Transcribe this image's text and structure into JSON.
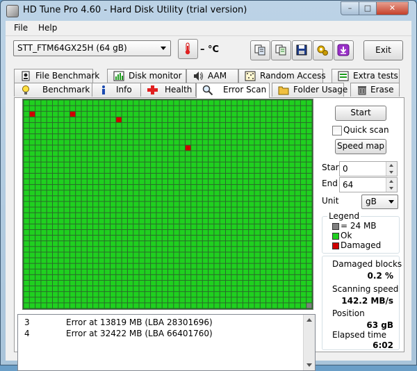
{
  "window": {
    "title": "HD Tune Pro 4.60 - Hard Disk Utility (trial version)",
    "controls": {
      "minimize": "–",
      "maximize": "□",
      "close": "✕"
    }
  },
  "menu": [
    "File",
    "Help"
  ],
  "toolbar": {
    "drive": "STT_FTM64GX25H (64 gB)",
    "temperature": "– °C",
    "exit_label": "Exit",
    "buttons": [
      "copy-info-icon",
      "copy-text-icon",
      "save-icon",
      "options-icon",
      "download-icon"
    ]
  },
  "tabs": {
    "row1": [
      "File Benchmark",
      "Disk monitor",
      "AAM",
      "Random Access",
      "Extra tests"
    ],
    "row2": [
      "Benchmark",
      "Info",
      "Health",
      "Error Scan",
      "Folder Usage",
      "Erase"
    ],
    "active": "Error Scan"
  },
  "scan_map": {
    "cols": 50,
    "rows": 37,
    "colors": {
      "ok": "#1fd01f",
      "damaged": "#d00000",
      "unscanned": "#7f7f7f",
      "gridline": "#2a6a2a"
    },
    "damaged_blocks": [
      [
        1,
        2
      ],
      [
        8,
        2
      ],
      [
        16,
        3
      ],
      [
        28,
        8
      ]
    ],
    "unscanned_blocks": [
      [
        49,
        36
      ]
    ]
  },
  "log": [
    {
      "index": "3",
      "message": "Error at 13819 MB (LBA 28301696)"
    },
    {
      "index": "4",
      "message": "Error at 32422 MB (LBA 66401760)"
    }
  ],
  "controls": {
    "start_label": "Start",
    "quick_scan_label": "Quick scan",
    "quick_scan_checked": false,
    "speed_map_label": "Speed map",
    "start_field_label": "Start",
    "start_value": "0",
    "end_field_label": "End",
    "end_value": "64",
    "unit_label": "Unit",
    "unit_value": "gB"
  },
  "legend": {
    "title": "Legend",
    "items": [
      {
        "label": "= 24 MB",
        "color": "#7f7f7f"
      },
      {
        "label": "Ok",
        "color": "#1fd01f"
      },
      {
        "label": "Damaged",
        "color": "#d00000"
      }
    ]
  },
  "stats": {
    "damaged_label": "Damaged blocks",
    "damaged_value": "0.2 %",
    "speed_label": "Scanning speed",
    "speed_value": "142.2 MB/s",
    "position_label": "Position",
    "position_value": "63 gB",
    "elapsed_label": "Elapsed time",
    "elapsed_value": "6:02"
  }
}
